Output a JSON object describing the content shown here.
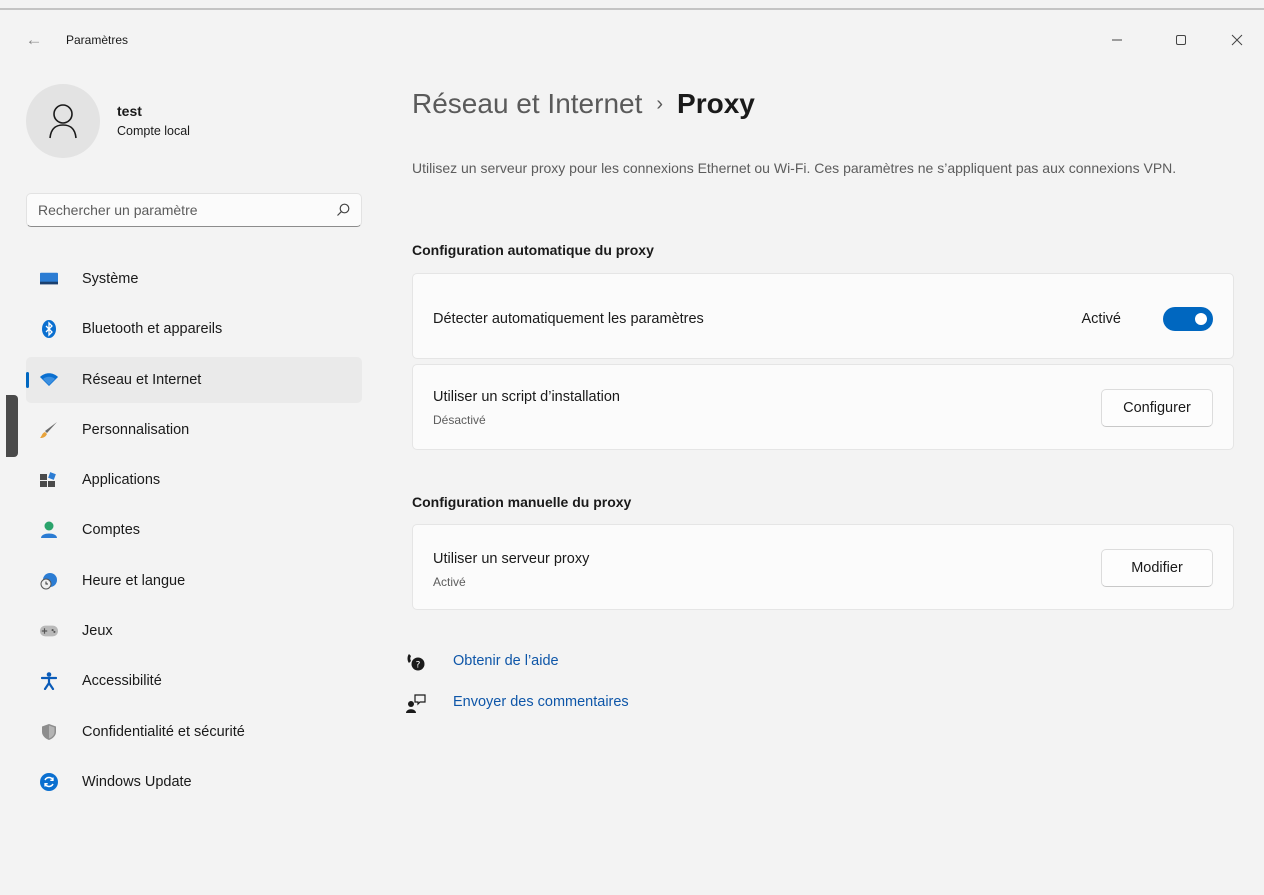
{
  "window": {
    "title": "Paramètres"
  },
  "profile": {
    "name": "test",
    "account_type": "Compte local"
  },
  "search": {
    "placeholder": "Rechercher un paramètre"
  },
  "nav": {
    "items": [
      {
        "label": "Système",
        "icon": "monitor-icon"
      },
      {
        "label": "Bluetooth et appareils",
        "icon": "bluetooth-icon"
      },
      {
        "label": "Réseau et Internet",
        "icon": "wifi-icon",
        "active": true
      },
      {
        "label": "Personnalisation",
        "icon": "brush-icon"
      },
      {
        "label": "Applications",
        "icon": "apps-icon"
      },
      {
        "label": "Comptes",
        "icon": "person-icon"
      },
      {
        "label": "Heure et langue",
        "icon": "globe-clock-icon"
      },
      {
        "label": "Jeux",
        "icon": "gamepad-icon"
      },
      {
        "label": "Accessibilité",
        "icon": "accessibility-icon"
      },
      {
        "label": "Confidentialité et sécurité",
        "icon": "shield-icon"
      },
      {
        "label": "Windows Update",
        "icon": "update-icon"
      }
    ]
  },
  "page": {
    "breadcrumb_parent": "Réseau et Internet",
    "breadcrumb_separator": "›",
    "title": "Proxy",
    "description": "Utilisez un serveur proxy pour les connexions Ethernet ou Wi-Fi. Ces paramètres ne s’appliquent pas aux connexions VPN."
  },
  "auto_section": {
    "title": "Configuration automatique du proxy",
    "detect": {
      "label": "Détecter automatiquement les paramètres",
      "state_label": "Activé",
      "on": true
    },
    "script": {
      "label": "Utiliser un script d’installation",
      "status": "Désactivé",
      "button": "Configurer"
    }
  },
  "manual_section": {
    "title": "Configuration manuelle du proxy",
    "proxy": {
      "label": "Utiliser un serveur proxy",
      "status": "Activé",
      "button": "Modifier"
    }
  },
  "links": {
    "help": "Obtenir de l’aide",
    "feedback": "Envoyer des commentaires"
  },
  "colors": {
    "accent": "#0067c0",
    "link": "#0e56a8"
  }
}
